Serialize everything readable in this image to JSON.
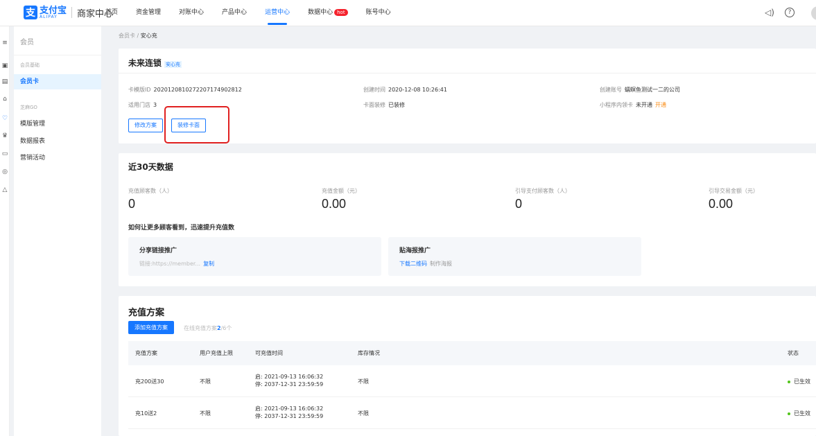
{
  "header": {
    "logo_cn": "支付宝",
    "logo_en": "ALIPAY",
    "merchant_center": "商家中心",
    "nav": [
      "首页",
      "资金管理",
      "对账中心",
      "产品中心",
      "运营中心",
      "数据中心",
      "账号中心"
    ],
    "active_nav": "运营中心",
    "hot_badge": "hot"
  },
  "sidebar": {
    "title": "会员",
    "group1": "会员基础",
    "item_card": "会员卡",
    "group2": "芝麻GO",
    "item_template": "模版管理",
    "item_report": "数据报表",
    "item_marketing": "营销活动"
  },
  "breadcrumb": {
    "parent": "会员卡",
    "sep": "/",
    "current": "安心充"
  },
  "card_info": {
    "title": "未来连锁",
    "tag": "安心充",
    "template_id_label": "卡模版ID",
    "template_id": "20201208102722071749028​12",
    "created_time_label": "创建时间",
    "created_time": "2020-12-08 10:26:41",
    "created_account_label": "创建账号",
    "created_account": "蠕螟鱼测试一二的公司",
    "stores_label": "适用门店",
    "stores": "3",
    "face_label": "卡面装修",
    "face_value": "已装修",
    "miniapp_label": "小程序内领卡",
    "miniapp_value": "未开通",
    "miniapp_action": "开通",
    "btn_modify": "修改方案",
    "btn_decorate": "装修卡面"
  },
  "stats": {
    "title": "近30天数据",
    "items": [
      {
        "label": "充值顾客数（人）",
        "value": "0"
      },
      {
        "label": "充值金额（元）",
        "value": "0.00"
      },
      {
        "label": "引导支付顾客数（人）",
        "value": "0"
      },
      {
        "label": "引导交易金额（元）",
        "value": "0.00"
      }
    ],
    "promo_heading": "如何让更多顾客看到，迅速提升充值数",
    "share_title": "分享链接推广",
    "share_link": "链接:https://member...",
    "share_copy": "复制",
    "poster_title": "贴海报推广",
    "poster_download": "下载二维码",
    "poster_make": "制作海报"
  },
  "plans": {
    "title": "充值方案",
    "add_button": "添加充值方案",
    "quota_prefix": "在线充值方案",
    "quota_used": "2",
    "quota_total": "/6个",
    "columns": [
      "充值方案",
      "用户充值上限",
      "可充值时间",
      "库存情况",
      "状态"
    ],
    "rows": [
      {
        "name": "充200送30",
        "limit": "不限",
        "start": "启: 2021-09-13 16:06:32",
        "end": "停: 2037-12-31 23:59:59",
        "stock": "不限",
        "status": "已生效"
      },
      {
        "name": "充10送2",
        "limit": "不限",
        "start": "启: 2021-09-13 16:06:32",
        "end": "停: 2037-12-31 23:59:59",
        "stock": "不限",
        "status": "已生效"
      }
    ]
  }
}
